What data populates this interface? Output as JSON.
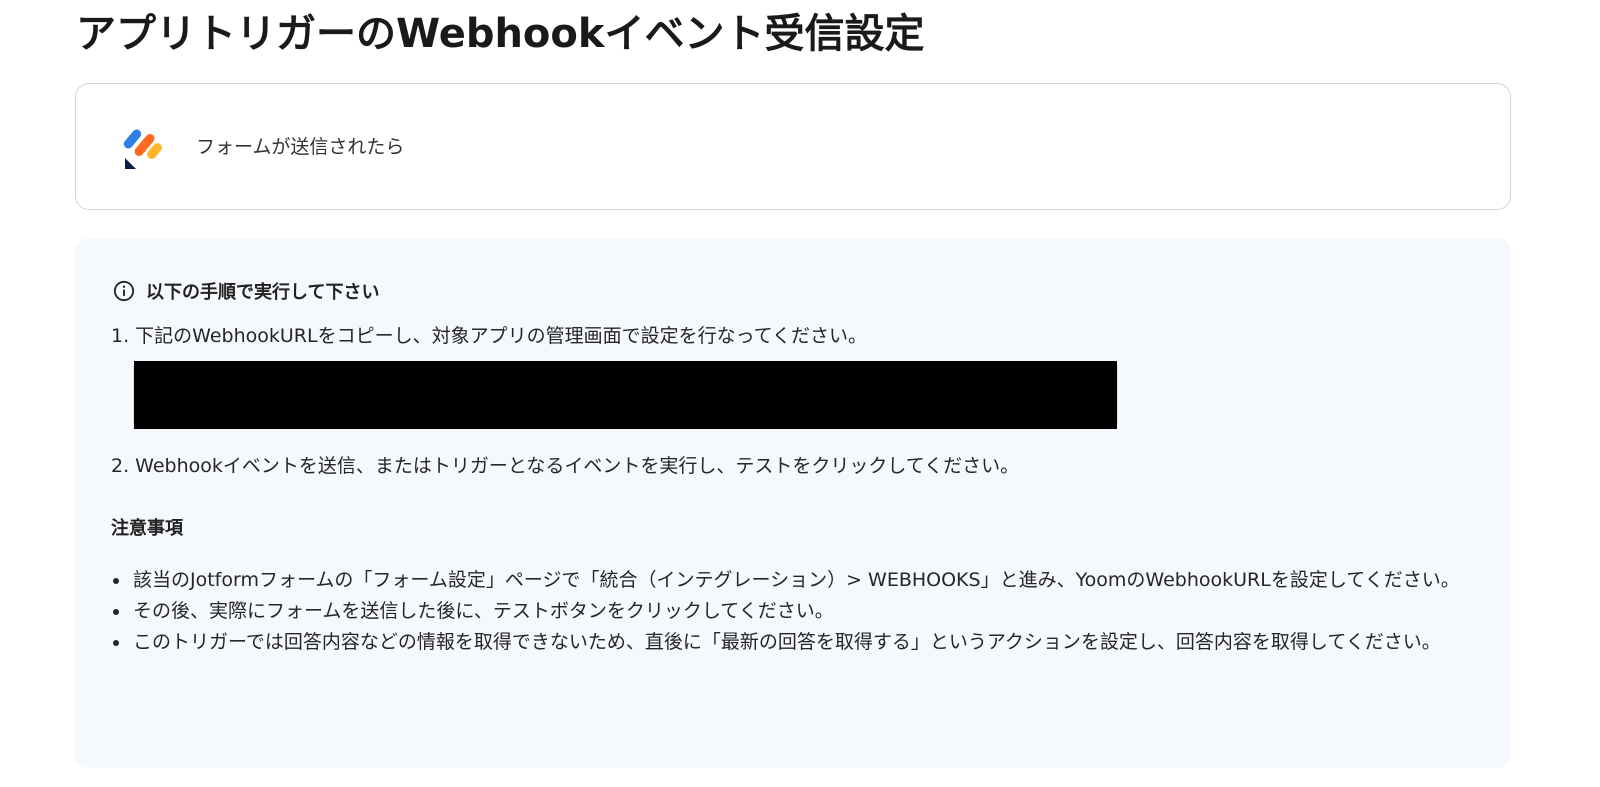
{
  "page": {
    "title": "アプリトリガーのWebhookイベント受信設定"
  },
  "trigger": {
    "app_icon": "jotform-logo",
    "label": "フォームが送信されたら"
  },
  "instructions": {
    "heading": "以下の手順で実行して下さい",
    "info_icon": "info-circle-icon",
    "step1": "1. 下記のWebhookURLをコピーし、対象アプリの管理画面で設定を行なってください。",
    "step2": "2. Webhookイベントを送信、またはトリガーとなるイベントを実行し、テストをクリックしてください。",
    "notes_heading": "注意事項",
    "notes": [
      "該当のJotformフォームの「フォーム設定」ページで「統合（インテグレーション）> WEBHOOKS」と進み、YoomのWebhookURLを設定してください。",
      "その後、実際にフォームを送信した後に、テストボタンをクリックしてください。",
      "このトリガーでは回答内容などの情報を取得できないため、直後に「最新の回答を取得する」というアクションを設定し、回答内容を取得してください。"
    ]
  },
  "colors": {
    "panel_bg": "#f5f8fc",
    "logo_blue": "#2f7fe6",
    "logo_orange": "#ff6a1f",
    "logo_yellow": "#ffb52a",
    "logo_navy": "#0b1e4a"
  }
}
